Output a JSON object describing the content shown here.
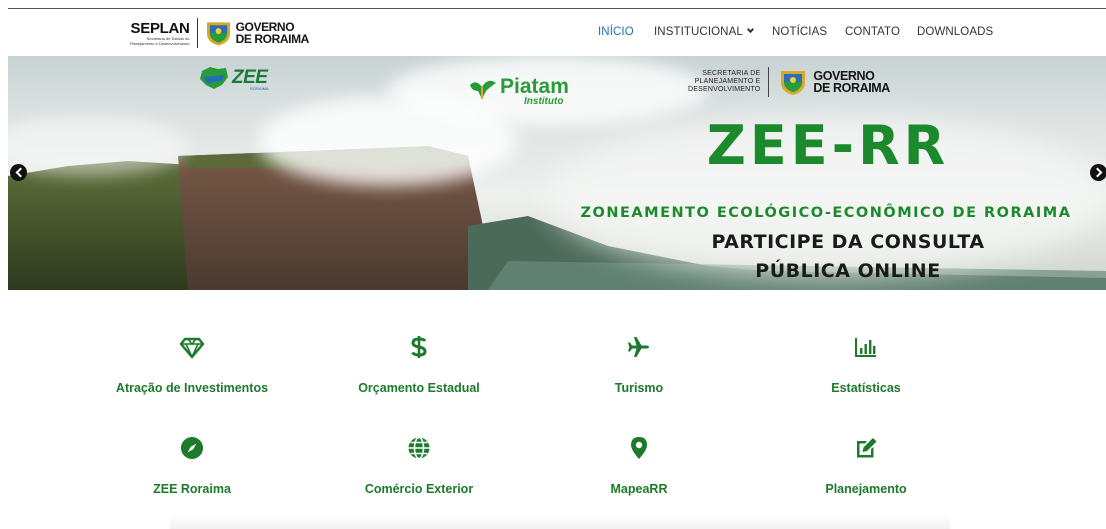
{
  "header": {
    "logo": {
      "org_name": "SEPLAN",
      "org_sub_1": "Secretaria de Estado do",
      "org_sub_2": "Planejamento e Desenvolvimento",
      "gov_line1": "GOVERNO",
      "gov_line2": "DE RORAIMA"
    },
    "nav": [
      {
        "label": "INÍCIO",
        "active": true
      },
      {
        "label": "INSTITUCIONAL",
        "dropdown": true
      },
      {
        "label": "NOTÍCIAS"
      },
      {
        "label": "CONTATO"
      },
      {
        "label": "DOWNLOADS"
      }
    ]
  },
  "banner": {
    "zee_logo_text": "ZEE",
    "zee_logo_sub": "RORAIMA",
    "piatam_name": "Piatam",
    "piatam_sub": "Instituto",
    "sec_line1": "SECRETARIA DE",
    "sec_line2": "PLANEJAMENTO E",
    "sec_line3": "DESENVOLVIMENTO",
    "gov_line1": "GOVERNO",
    "gov_line2": "DE RORAIMA",
    "headline": "ZEE-RR",
    "subheadline": "ZONEAMENTO ECOLÓGICO-ECONÔMICO DE RORAIMA",
    "cta_line1": "PARTICIPE DA CONSULTA",
    "cta_line2": "PÚBLICA ONLINE"
  },
  "services": [
    {
      "label": "Atração de Investimentos",
      "icon": "diamond-icon"
    },
    {
      "label": "Orçamento Estadual",
      "icon": "dollar-icon"
    },
    {
      "label": "Turismo",
      "icon": "plane-icon"
    },
    {
      "label": "Estatísticas",
      "icon": "bar-chart-icon"
    },
    {
      "label": "ZEE Roraima",
      "icon": "compass-icon"
    },
    {
      "label": "Comércio Exterior",
      "icon": "globe-icon"
    },
    {
      "label": "MapeaRR",
      "icon": "map-marker-icon"
    },
    {
      "label": "Planejamento",
      "icon": "edit-icon"
    }
  ],
  "colors": {
    "brand_green": "#1c7a2a",
    "nav_active": "#1f6fb8",
    "nav_text": "#333333"
  }
}
